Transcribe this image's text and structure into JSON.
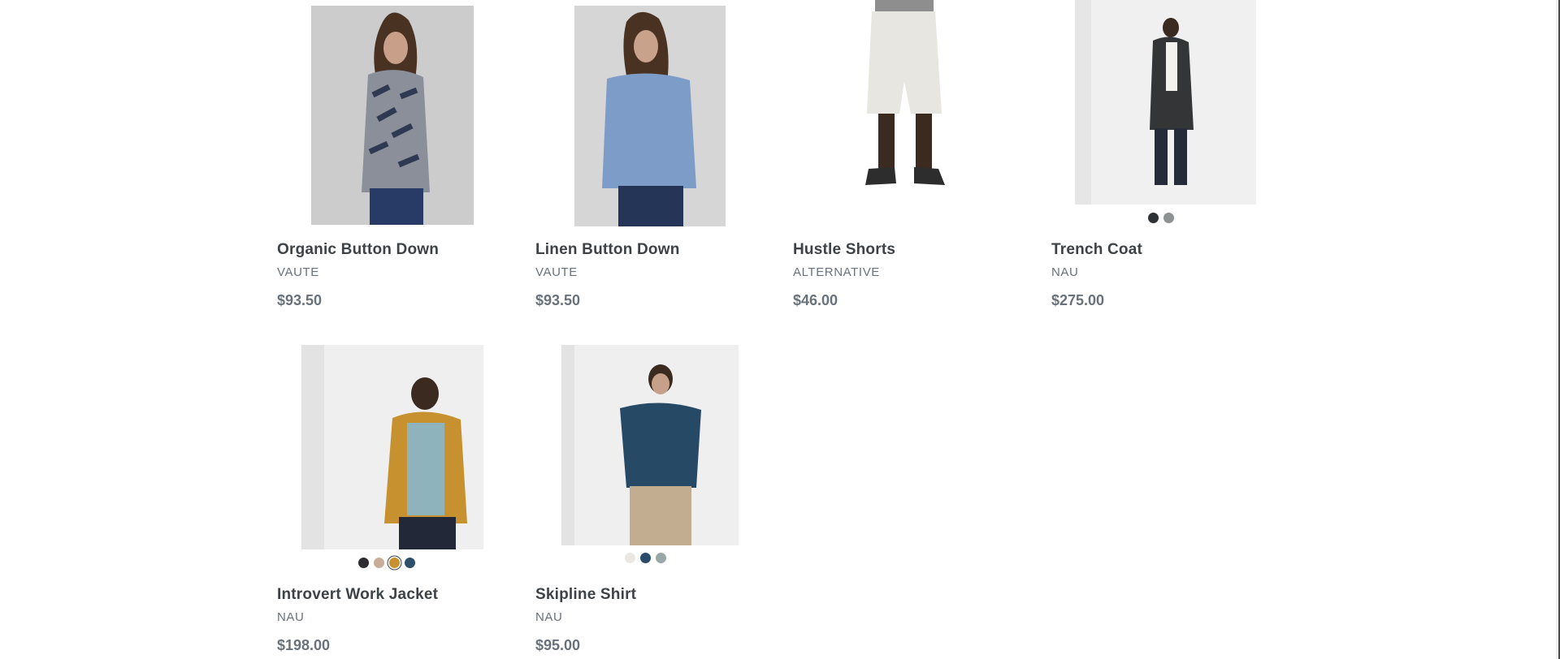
{
  "products": [
    {
      "title": "Organic Button Down",
      "vendor": "VAUTE",
      "price": "$93.50",
      "image": "man-patterned-shirt-photo",
      "swatches": []
    },
    {
      "title": "Linen Button Down",
      "vendor": "VAUTE",
      "price": "$93.50",
      "image": "man-blue-linen-shirt-photo",
      "swatches": []
    },
    {
      "title": "Hustle Shorts",
      "vendor": "ALTERNATIVE",
      "price": "$46.00",
      "image": "grey-shorts-photo",
      "swatches": []
    },
    {
      "title": "Trench Coat",
      "vendor": "NAU",
      "price": "$275.00",
      "image": "man-trench-coat-photo",
      "swatches": [
        "#2f3235",
        "#8e9192"
      ]
    },
    {
      "title": "Introvert Work Jacket",
      "vendor": "NAU",
      "price": "$198.00",
      "image": "man-mustard-jacket-photo",
      "swatches": [
        "#2b2d30",
        "#c8ae98",
        "#c8912f",
        "#2d4f6a"
      ],
      "selected_swatch": 2
    },
    {
      "title": "Skipline Shirt",
      "vendor": "NAU",
      "price": "$95.00",
      "image": "man-navy-shirt-photo",
      "swatches": [
        "#ebe8e3",
        "#294a6b",
        "#9aa7a7"
      ]
    }
  ]
}
